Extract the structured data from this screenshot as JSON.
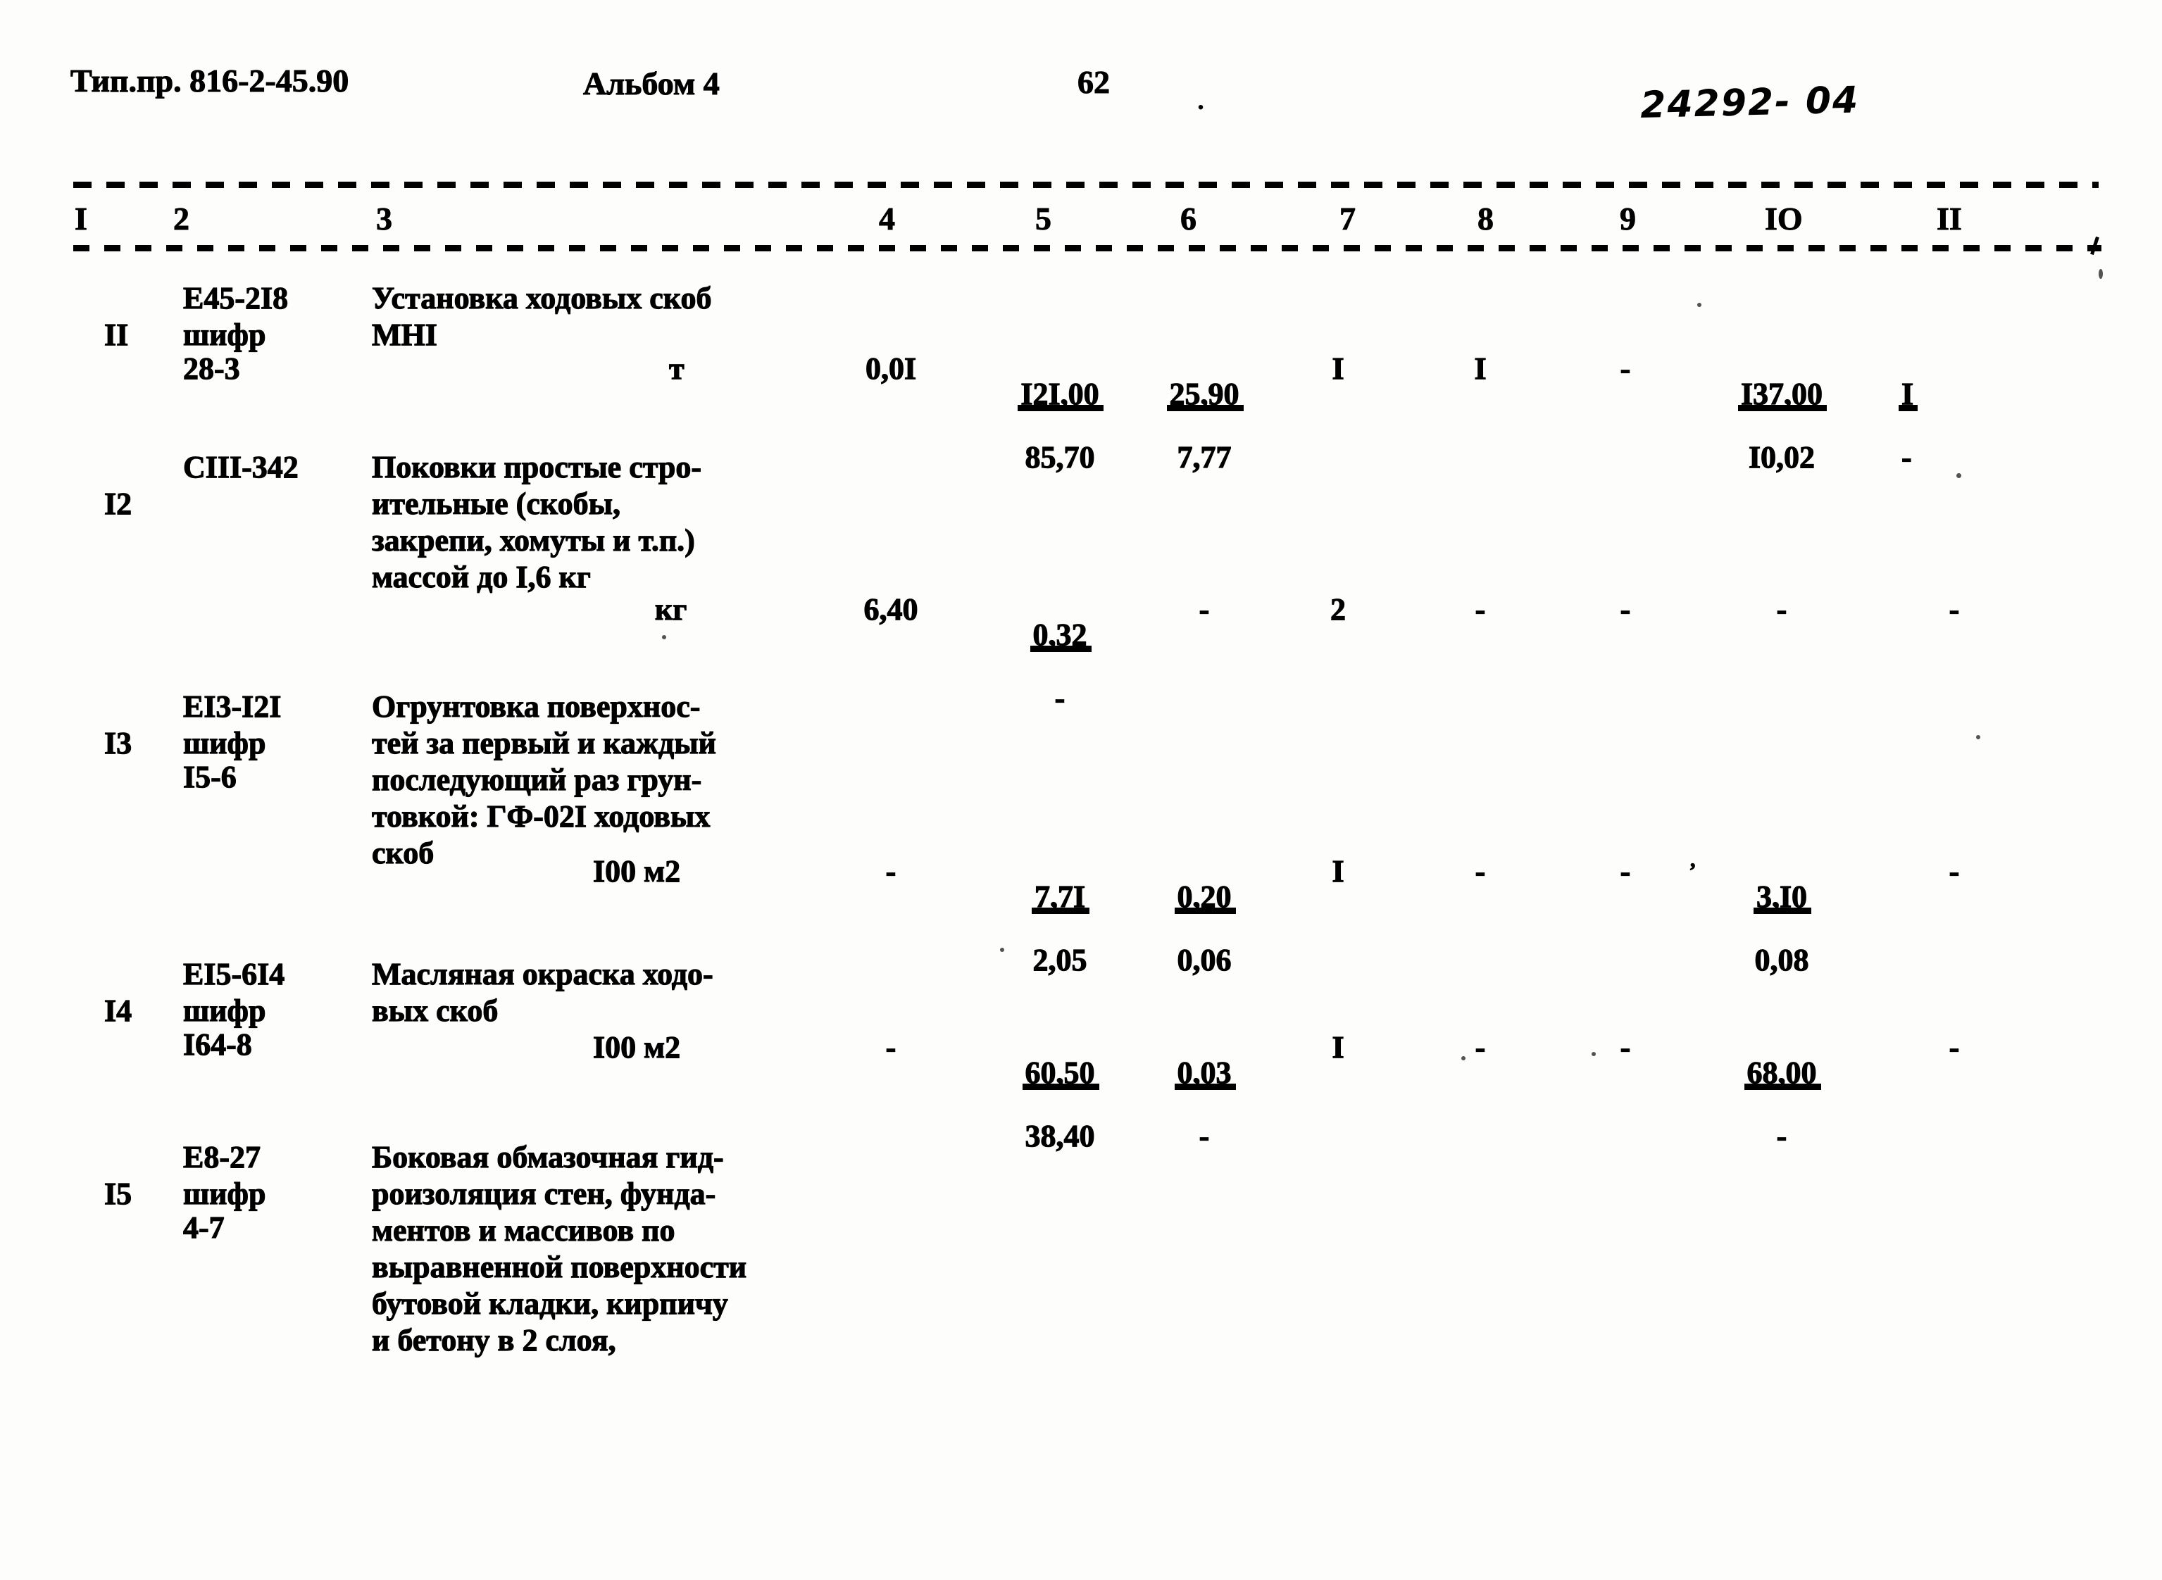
{
  "header": {
    "project_label": "Тип.пр. 816-2-45.90",
    "album_label": "Альбом 4",
    "page_number": "62",
    "dot": ".",
    "doc_code": "24292- 04"
  },
  "table": {
    "column_headers": [
      "I",
      "2",
      "3",
      "4",
      "5",
      "6",
      "7",
      "8",
      "9",
      "IO",
      "II"
    ],
    "rows": [
      {
        "num": "II",
        "code_lines": [
          "E45-2I8",
          "шифр",
          "28-3"
        ],
        "description_lines": [
          "Установка ходовых скоб",
          "МНI"
        ],
        "unit": "т",
        "c4": "0,0I",
        "c5_top": "I2I,00",
        "c5_bot": "85,70",
        "c6_top": "25,90",
        "c6_bot": "7,77",
        "c7": "I",
        "c8": "I",
        "c9": "-",
        "c10_top": "I37,00",
        "c10_bot": "I0,02",
        "c11_top": "I",
        "c11_bot": "-"
      },
      {
        "num": "I2",
        "code_lines": [
          "CIII-342"
        ],
        "description_lines": [
          "Поковки простые стро-",
          "ительные (скобы,",
          "закрепи, хомуты и т.п.)",
          "массой до I,6 кг"
        ],
        "unit": "кг",
        "c4": "6,40",
        "c5_top": "0,32",
        "c5_bot": "-",
        "c6_top": "-",
        "c6_bot": "",
        "c7": "2",
        "c8": "-",
        "c9": "-",
        "c10_top": "-",
        "c10_bot": "",
        "c11_top": "-",
        "c11_bot": ""
      },
      {
        "num": "I3",
        "code_lines": [
          "EI3-I2I",
          "шифр",
          "I5-6"
        ],
        "description_lines": [
          "Огрунтовка поверхнос-",
          "тей за первый и каждый",
          "последующий раз грун-",
          "товкой: ГФ-02I ходовых",
          "скоб"
        ],
        "unit": "I00 м2",
        "c4": "-",
        "c5_top": "7,7I",
        "c5_bot": "2,05",
        "c6_top": "0,20",
        "c6_bot": "0,06",
        "c7": "I",
        "c8": "-",
        "c9": "-",
        "c10_top": "3,I0",
        "c10_bot": "0,08",
        "c11_top": "-",
        "c11_bot": ""
      },
      {
        "num": "I4",
        "code_lines": [
          "EI5-6I4",
          "шифр",
          "I64-8"
        ],
        "description_lines": [
          "Масляная окраска ходо-",
          "вых скоб"
        ],
        "unit": "I00 м2",
        "c4": "-",
        "c5_top": "60,50",
        "c5_bot": "38,40",
        "c6_top": "0,03",
        "c6_bot": "-",
        "c7": "I",
        "c8": "-",
        "c9": "-",
        "c10_top": "68,00",
        "c10_bot": "-",
        "c11_top": "-",
        "c11_bot": ""
      },
      {
        "num": "I5",
        "code_lines": [
          "E8-27",
          "шифр",
          "4-7"
        ],
        "description_lines": [
          "Боковая обмазочная гид-",
          "роизоляция стен, фунда-",
          "ментов и массивов по",
          "выравненной поверхности",
          "бутовой кладки, кирпичу",
          "и бетону в 2 слоя,"
        ],
        "unit": "",
        "c4": "",
        "c5_top": "",
        "c5_bot": "",
        "c6_top": "",
        "c6_bot": "",
        "c7": "",
        "c8": "",
        "c9": "",
        "c10_top": "",
        "c10_bot": "",
        "c11_top": "",
        "c11_bot": ""
      }
    ]
  },
  "colors": {
    "ink": "#000000",
    "paper": "#fdfdfb"
  }
}
